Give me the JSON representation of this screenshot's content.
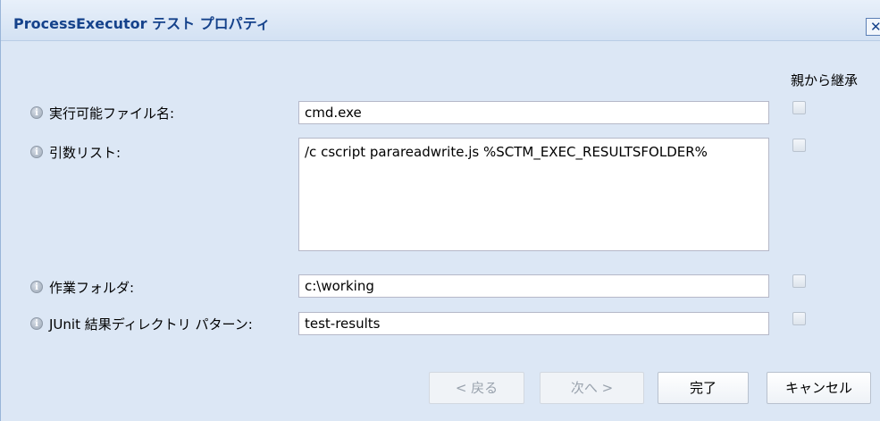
{
  "window": {
    "title": "ProcessExecutor テスト プロパティ",
    "close_glyph": "✕"
  },
  "inherit_header": "親から継承",
  "fields": {
    "executable": {
      "label": "実行可能ファイル名:",
      "value": "cmd.exe"
    },
    "arguments": {
      "label": "引数リスト:",
      "value": "/c cscript parareadwrite.js %SCTM_EXEC_RESULTSFOLDER%"
    },
    "working_folder": {
      "label": "作業フォルダ:",
      "value": "c:\\working"
    },
    "junit_pattern": {
      "label": "JUnit 結果ディレクトリ パターン:",
      "value": "test-results"
    }
  },
  "info_glyph": "i",
  "buttons": {
    "back": "< 戻る",
    "next": "次へ >",
    "finish": "完了",
    "cancel": "キャンセル"
  },
  "icons": [
    "info-icon",
    "close-icon"
  ]
}
